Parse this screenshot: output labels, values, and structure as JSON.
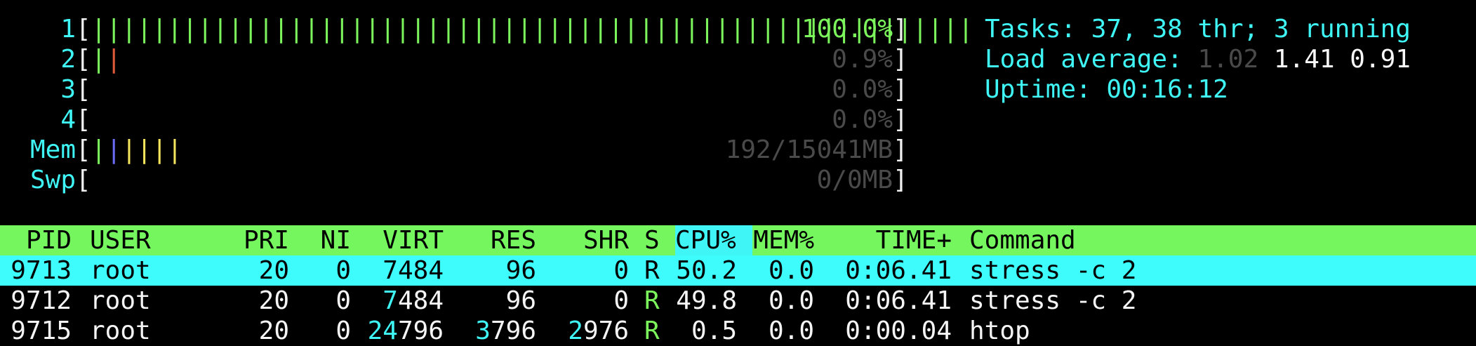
{
  "meters": [
    {
      "label": "1",
      "bars": [
        {
          "text": "||||||||||||||||||||||||||||||||||||||||||||||||||||||||||",
          "color": "#7cf55c"
        }
      ],
      "value": "100.0%",
      "value_color": "#7cf55c"
    },
    {
      "label": "2",
      "bars": [
        {
          "text": "|",
          "color": "#7cf55c"
        },
        {
          "text": "|",
          "color": "#e05a3a"
        }
      ],
      "value": "0.9%",
      "value_color": "#4a4a4a"
    },
    {
      "label": "3",
      "bars": [],
      "value": "0.0%",
      "value_color": "#4a4a4a"
    },
    {
      "label": "4",
      "bars": [],
      "value": "0.0%",
      "value_color": "#4a4a4a"
    },
    {
      "label": "Mem",
      "bars": [
        {
          "text": "|",
          "color": "#7cf55c"
        },
        {
          "text": "|",
          "color": "#6a6af5"
        },
        {
          "text": "||||",
          "color": "#f5e55c"
        }
      ],
      "value": "192/15041MB",
      "value_color": "#4a4a4a"
    },
    {
      "label": "Swp",
      "bars": [],
      "value": "0/0MB",
      "value_color": "#4a4a4a"
    }
  ],
  "summary": {
    "tasks_label": "Tasks:",
    "tasks_procs": "37,",
    "tasks_threads": "38",
    "tasks_thr_label": "thr;",
    "tasks_running": "3",
    "tasks_running_label": "running",
    "load_label": "Load average:",
    "load_1": "1.02",
    "load_5": "1.41",
    "load_15": "0.91",
    "uptime_label": "Uptime:",
    "uptime": "00:16:12"
  },
  "columns": [
    "PID",
    "USER",
    "PRI",
    "NI",
    "VIRT",
    "RES",
    "SHR",
    "S",
    "CPU%",
    "MEM%",
    "TIME+",
    "Command"
  ],
  "sorted_column": "CPU%",
  "processes": [
    {
      "pid": "9713",
      "user": "root",
      "pri": "20",
      "ni": "0",
      "virt": "7484",
      "res": "96",
      "shr": "0",
      "s": "R",
      "cpu": "50.2",
      "mem": "0.0",
      "time": "0:06.41",
      "command": "stress -c 2",
      "selected": true
    },
    {
      "pid": "9712",
      "user": "root",
      "pri": "20",
      "ni": "0",
      "virt": "7484",
      "res": "96",
      "shr": "0",
      "s": "R",
      "cpu": "49.8",
      "mem": "0.0",
      "time": "0:06.41",
      "command": "stress -c 2",
      "selected": false
    },
    {
      "pid": "9715",
      "user": "root",
      "pri": "20",
      "ni": "0",
      "virt": "24796",
      "res": "3796",
      "shr": "2976",
      "s": "R",
      "cpu": "0.5",
      "mem": "0.0",
      "time": "0:00.04",
      "command": "htop",
      "selected": false
    }
  ],
  "colors": {
    "header_bg": "#75f55e",
    "selected_bg": "#3ffcfc",
    "cyan": "#3ff5f5",
    "green": "#7cf55c",
    "dim": "#4a4a4a"
  }
}
